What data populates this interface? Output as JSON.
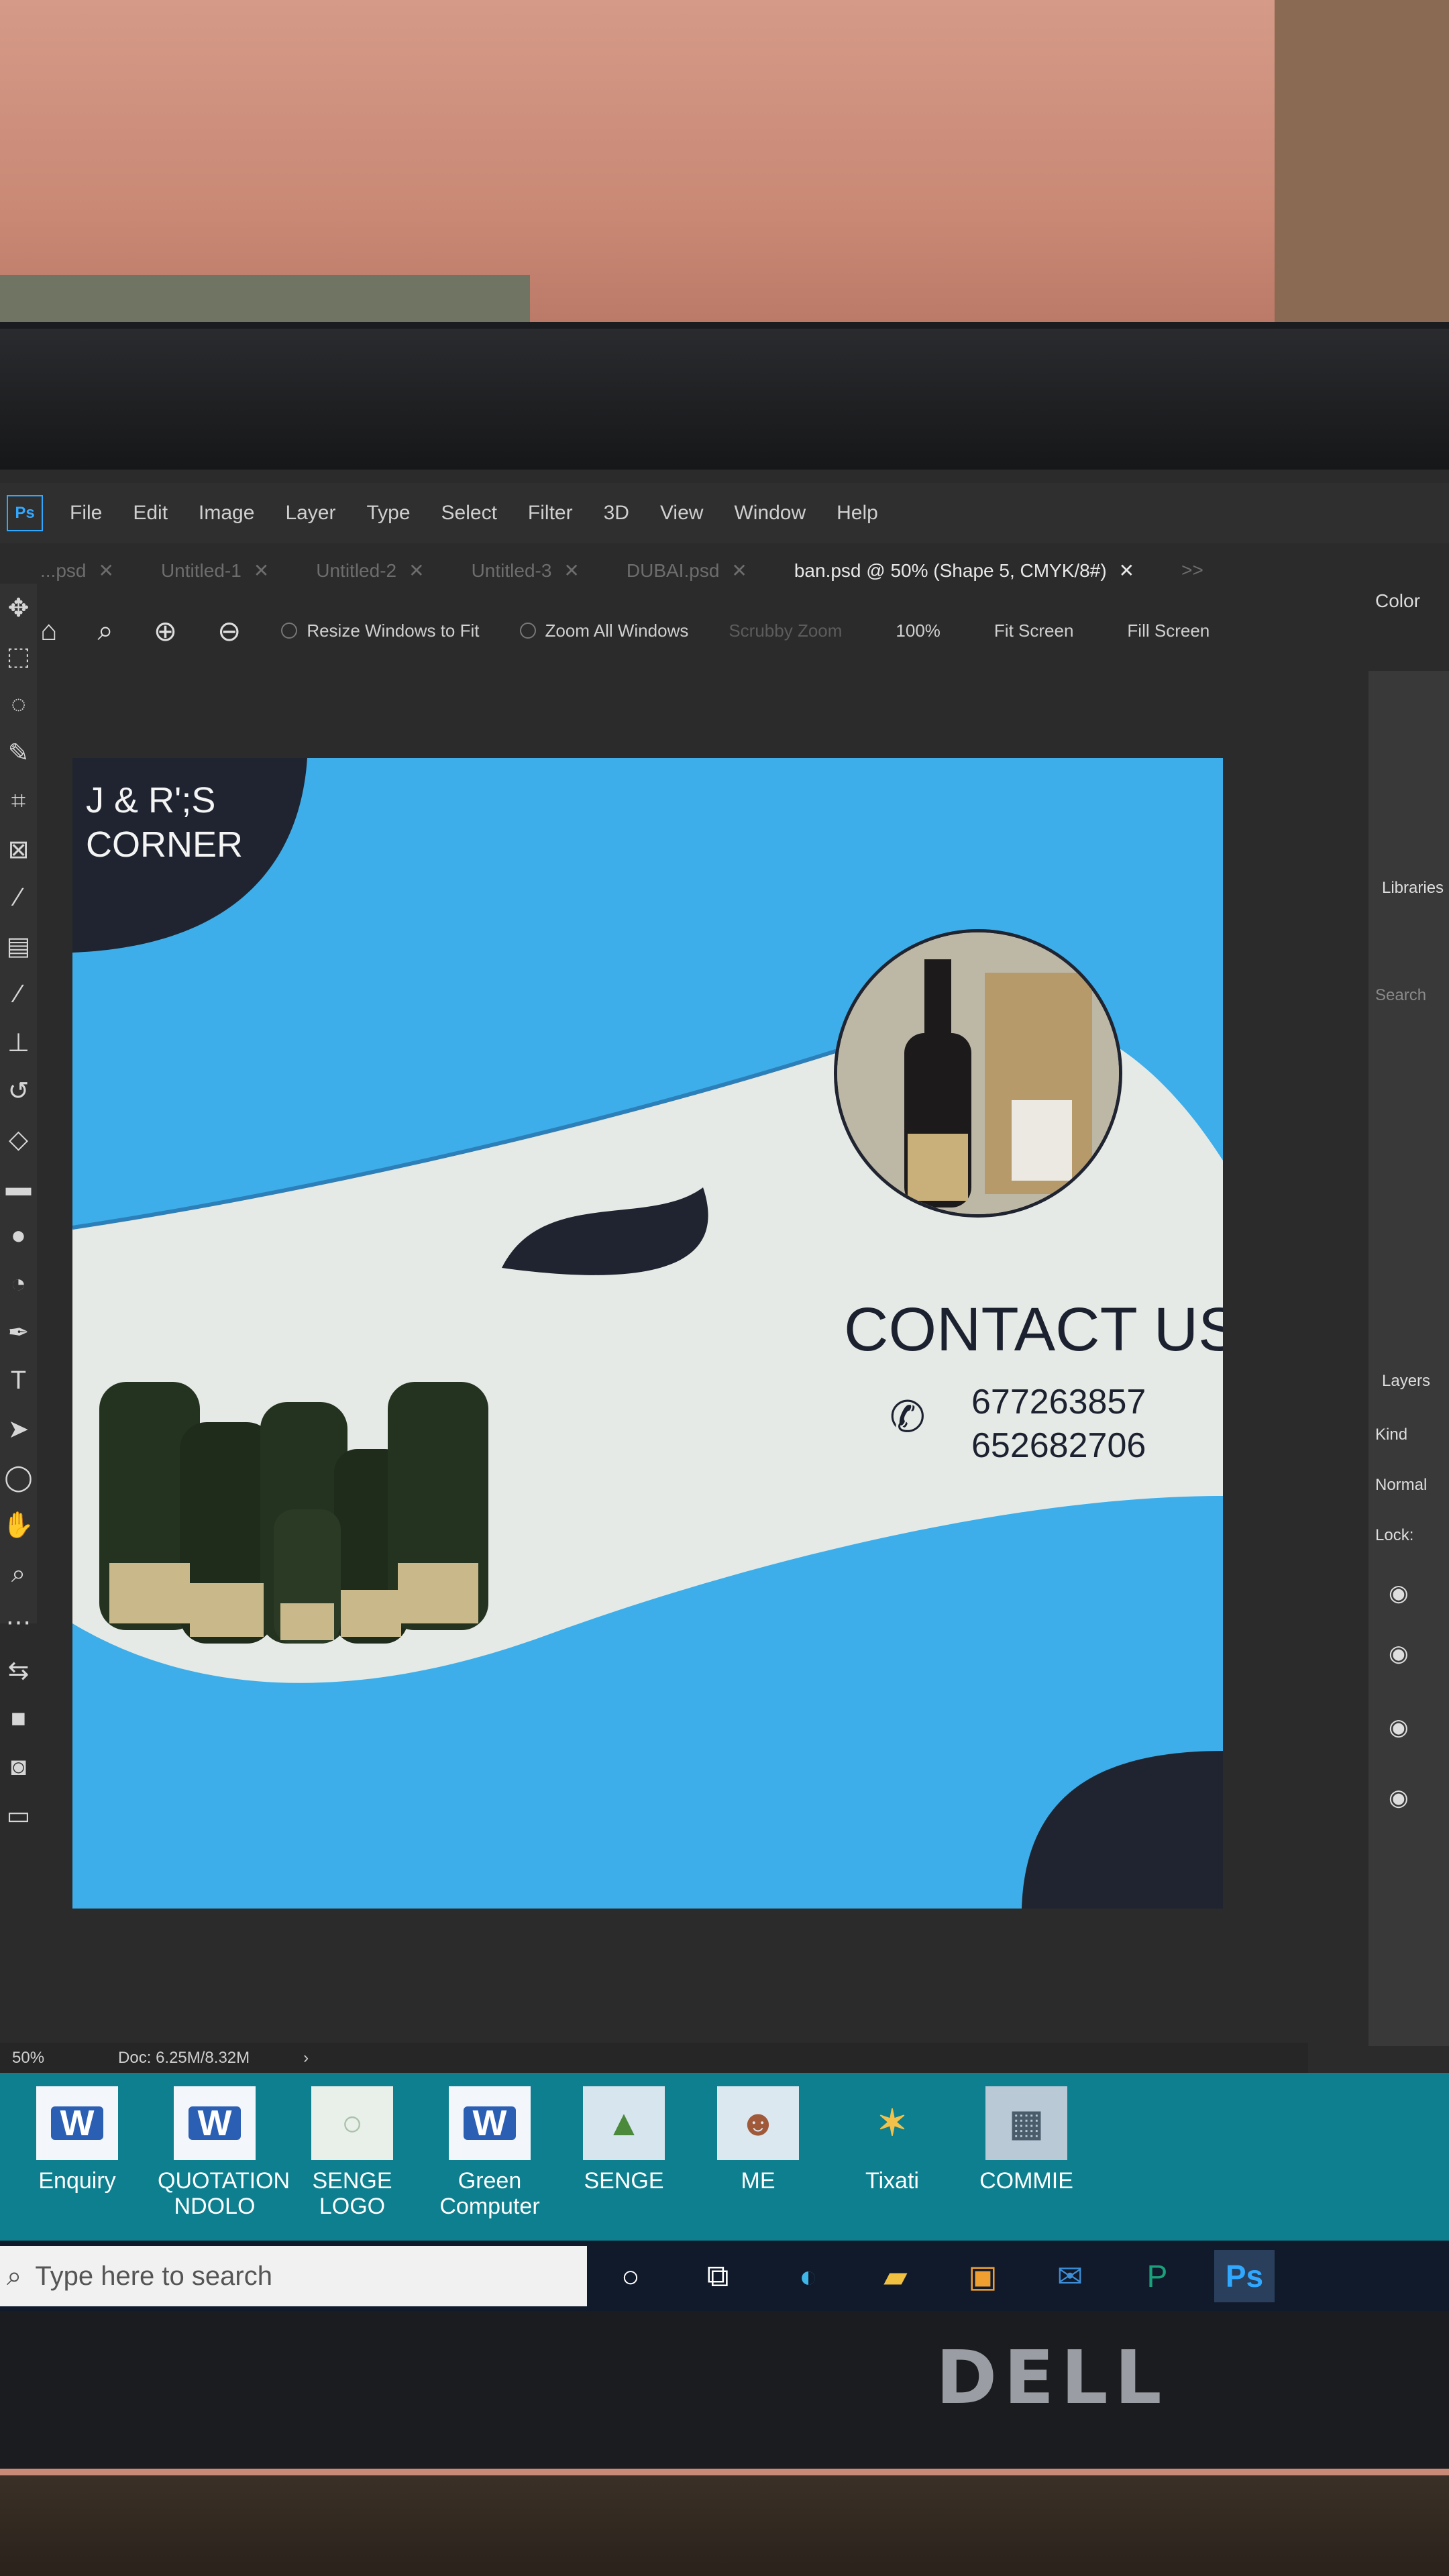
{
  "menubar": {
    "logo": "Ps",
    "items": [
      "File",
      "Edit",
      "Image",
      "Layer",
      "Type",
      "Select",
      "Filter",
      "3D",
      "View",
      "Window",
      "Help"
    ]
  },
  "tabs": [
    {
      "label": "...psd"
    },
    {
      "label": "Untitled-1"
    },
    {
      "label": "Untitled-2"
    },
    {
      "label": "Untitled-3"
    },
    {
      "label": "DUBAI.psd"
    },
    {
      "label": "ban.psd @ 50% (Shape 5, CMYK/8#)"
    }
  ],
  "tabs_overflow": ">>",
  "options": {
    "resize_windows": "Resize Windows to Fit",
    "zoom_all": "Zoom All Windows",
    "scrubby_zoom": "Scrubby Zoom",
    "zoom_100": "100%",
    "fit_screen": "Fit Screen",
    "fill_screen": "Fill Screen"
  },
  "panels": {
    "color": "Color",
    "libraries": "Libraries",
    "search_placeholder": "Search",
    "layers": "Layers",
    "kind": "Kind",
    "blend_mode": "Normal",
    "lock": "Lock:"
  },
  "canvas": {
    "brand": [
      "J & R';S",
      "CORNER"
    ],
    "contact_title": "CONTACT US",
    "phone1": "677263857",
    "phone2": "652682706",
    "colors": {
      "blue": "#3daee9",
      "dark": "#1f2430",
      "white": "#e9ece9"
    }
  },
  "status": {
    "zoom": "50%",
    "doc": "Doc: 6.25M/8.32M"
  },
  "desktop_icons": [
    {
      "label": "Enquiry",
      "type": "word"
    },
    {
      "label": "QUOTATION NDOLO",
      "type": "word"
    },
    {
      "label": "SENGE LOGO",
      "type": "image"
    },
    {
      "label": "Green Computer",
      "type": "word"
    },
    {
      "label": "SENGE",
      "type": "image"
    },
    {
      "label": "ME",
      "type": "image"
    },
    {
      "label": "Tixati",
      "type": "app"
    },
    {
      "label": "COMMIE",
      "type": "image"
    }
  ],
  "taskbar": {
    "search_placeholder": "Type here to search",
    "apps": [
      "cortana",
      "task-view",
      "edge",
      "file-explorer",
      "store",
      "mail",
      "publisher",
      "photoshop"
    ]
  },
  "monitor_brand": "DELL"
}
